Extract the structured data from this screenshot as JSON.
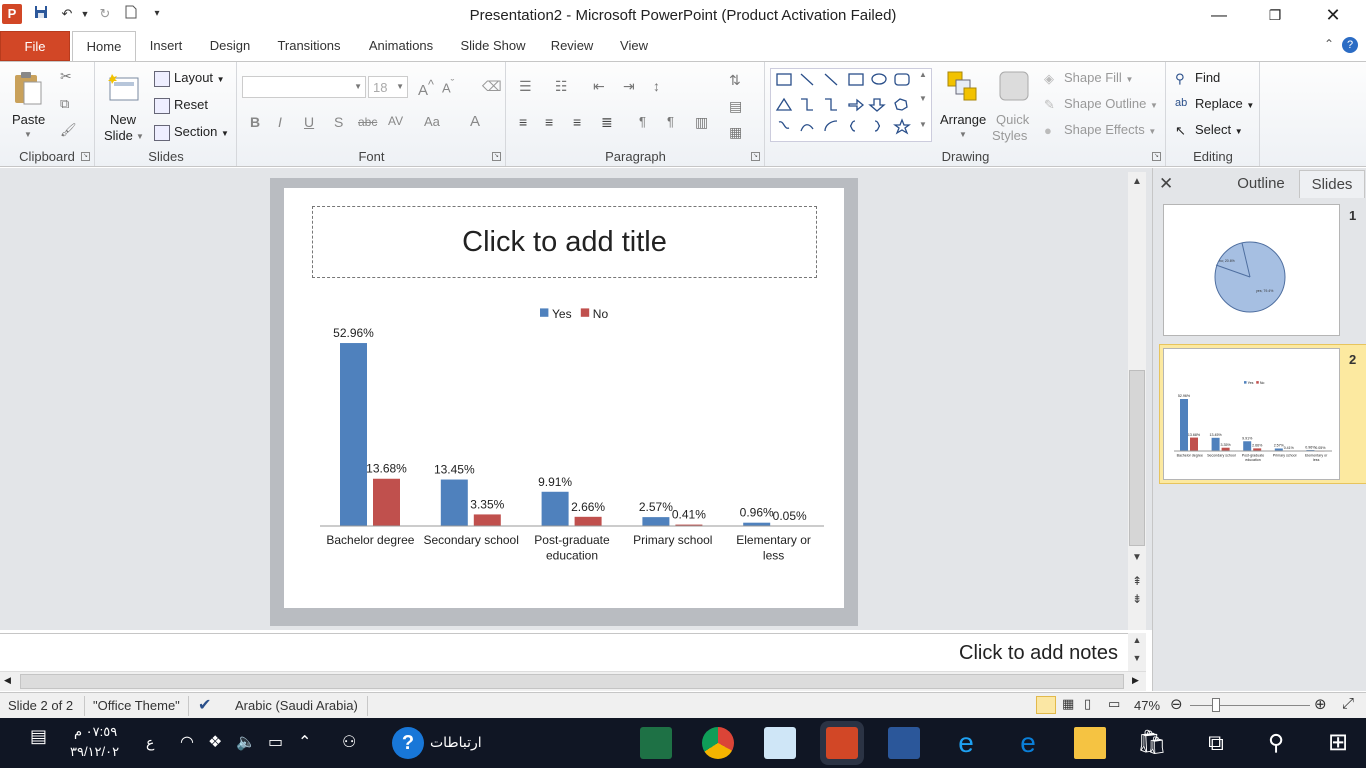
{
  "window": {
    "title": "Presentation2  -  Microsoft PowerPoint (Product Activation Failed)",
    "app_icon_letter": "P"
  },
  "tabs": [
    "File",
    "Home",
    "Insert",
    "Design",
    "Transitions",
    "Animations",
    "Slide Show",
    "Review",
    "View"
  ],
  "ribbon": {
    "clipboard": {
      "label": "Clipboard",
      "paste": "Paste"
    },
    "slides": {
      "label": "Slides",
      "new_slide": "New",
      "new_slide_2": "Slide",
      "layout": "Layout",
      "reset": "Reset",
      "section": "Section"
    },
    "font": {
      "label": "Font",
      "font_name": "",
      "font_size": "18"
    },
    "paragraph": {
      "label": "Paragraph"
    },
    "drawing": {
      "label": "Drawing",
      "arrange": "Arrange",
      "quick": "Quick",
      "styles": "Styles",
      "shape_fill": "Shape Fill",
      "shape_outline": "Shape Outline",
      "shape_effects": "Shape Effects"
    },
    "editing": {
      "label": "Editing",
      "find": "Find",
      "replace": "Replace",
      "select": "Select"
    }
  },
  "slide": {
    "title_placeholder": "Click to add title"
  },
  "chart_data": {
    "type": "bar",
    "categories": [
      "Bachelor degree",
      "Secondary school",
      "Post-graduate education",
      "Primary school",
      "Elementary or less"
    ],
    "category_lines": [
      [
        "Bachelor degree"
      ],
      [
        "Secondary school"
      ],
      [
        "Post-graduate",
        "education"
      ],
      [
        "Primary school"
      ],
      [
        "Elementary or",
        "less"
      ]
    ],
    "series": [
      {
        "name": "Yes",
        "values": [
          52.96,
          13.45,
          9.91,
          2.57,
          0.96
        ],
        "labels": [
          "52.96%",
          "13.45%",
          "9.91%",
          "2.57%",
          "0.96%"
        ],
        "color": "#4f81bd"
      },
      {
        "name": "No",
        "values": [
          13.68,
          3.35,
          2.66,
          0.41,
          0.05
        ],
        "labels": [
          "13.68%",
          "3.35%",
          "2.66%",
          "0.41%",
          "0.05%"
        ],
        "color": "#c0504d"
      }
    ],
    "ylim": [
      0,
      55
    ],
    "legend": "top",
    "grid": false
  },
  "notes": {
    "placeholder": "Click to add notes"
  },
  "pane": {
    "tab_outline": "Outline",
    "tab_slides": "Slides",
    "slide1_num": "1",
    "slide2_num": "2",
    "thumb1_labels": [
      "yes; 79.4%",
      "no; 20.6%"
    ]
  },
  "status": {
    "slide": "Slide 2 of 2",
    "theme": "\"Office Theme\"",
    "language": "Arabic (Saudi Arabia)",
    "zoom": "47%"
  },
  "taskbar": {
    "time": "٠٧:٥٩ م",
    "date": "٣٩/١٢/٠٢",
    "lang": "ع",
    "search_text": "ارتباطات"
  }
}
